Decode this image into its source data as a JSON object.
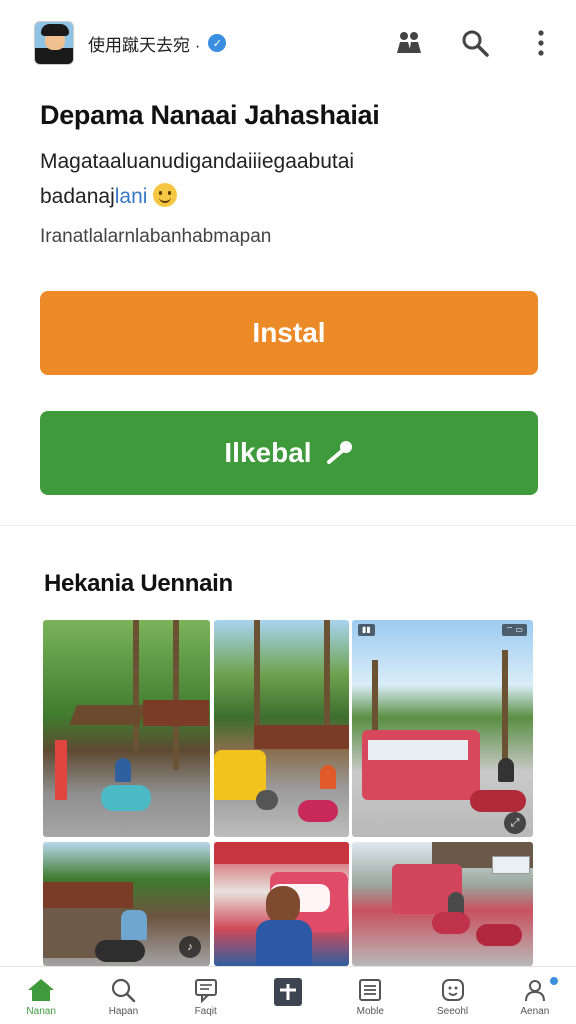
{
  "header": {
    "account_name": "使用蹴天去宛 ·",
    "verified_icon": "check-badge-icon",
    "actions": [
      "people-icon",
      "search-icon",
      "more-vertical-icon"
    ]
  },
  "app": {
    "title": "Depama Nanaai Jahashaiai",
    "description_line1": "Magataaluanudigandaiiiegaabutai",
    "description_line2_prefix": "badanaj",
    "description_line2_highlight": "lani",
    "meta": "Iranatlalarnlabanhabmapan"
  },
  "buttons": {
    "install_label": "Instal",
    "share_label": "Ilkebal",
    "install_color": "#ec8a28",
    "share_color": "#3f9a3c"
  },
  "gallery": {
    "title": "Hekania Uennain",
    "tile_count": 6
  },
  "nav": {
    "items": [
      {
        "label": "Nanan",
        "icon": "home-icon",
        "active": true
      },
      {
        "label": "Hapan",
        "icon": "search-icon",
        "active": false
      },
      {
        "label": "Faqit",
        "icon": "chat-icon",
        "active": false
      },
      {
        "label": "",
        "icon": "add-icon",
        "active": false
      },
      {
        "label": "Moble",
        "icon": "list-icon",
        "active": false
      },
      {
        "label": "Seeohl",
        "icon": "face-icon",
        "active": false
      },
      {
        "label": "Aenan",
        "icon": "profile-icon",
        "active": false
      }
    ]
  }
}
